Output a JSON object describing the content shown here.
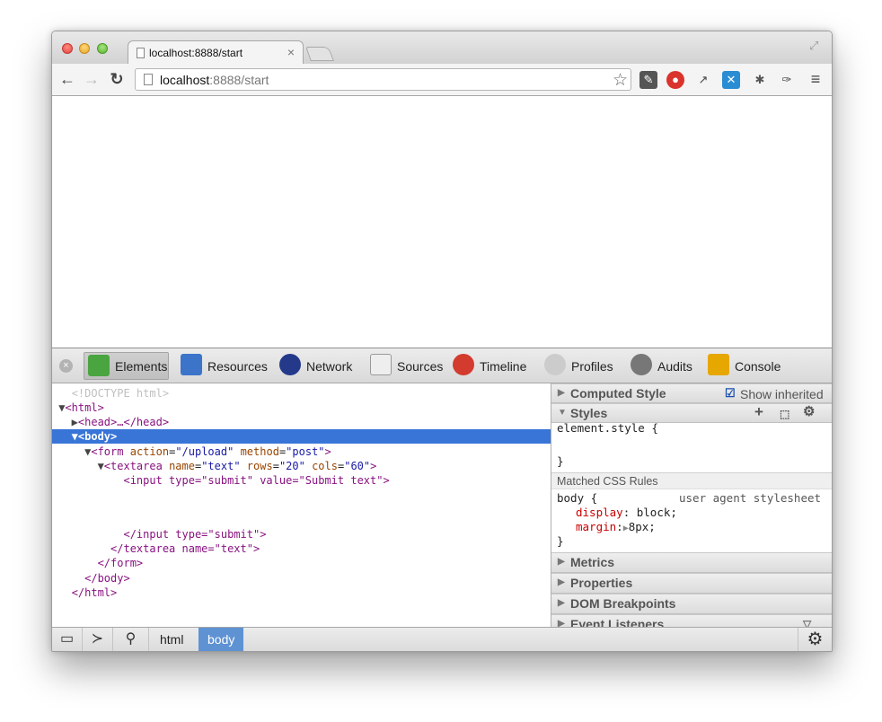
{
  "browser": {
    "tab_title": "localhost:8888/start",
    "tab_close": "×",
    "url_host": "localhost",
    "url_path": ":8888/start",
    "back_icon": "←",
    "forward_icon": "→",
    "reload_icon": "↻",
    "star_icon": "☆",
    "menu_icon": "≡",
    "fullscreen_icon": "⤢"
  },
  "devtools": {
    "close_icon": "×",
    "tabs": [
      {
        "label": "Elements",
        "icon": "elements-icon",
        "color": "#4aa540"
      },
      {
        "label": "Resources",
        "icon": "resources-icon",
        "color": "#3b74c9"
      },
      {
        "label": "Network",
        "icon": "network-icon",
        "color": "#24398a"
      },
      {
        "label": "Sources",
        "icon": "sources-icon",
        "color": "#cc3333"
      },
      {
        "label": "Timeline",
        "icon": "timeline-icon",
        "color": "#d23b2e"
      },
      {
        "label": "Profiles",
        "icon": "profiles-icon",
        "color": "#999999"
      },
      {
        "label": "Audits",
        "icon": "audits-icon",
        "color": "#555555"
      },
      {
        "label": "Console",
        "icon": "console-icon",
        "color": "#e6a700"
      }
    ],
    "dom": {
      "doctype": "<!DOCTYPE html>",
      "html_open": "<html>",
      "head": "<head>…</head>",
      "body_open": "<body>",
      "form_tag": "<form",
      "form_attr1": "action",
      "form_val1": "\"/upload\"",
      "form_attr2": "method",
      "form_val2": "\"post\"",
      "textarea_tag": "<textarea",
      "ta_attr1": "name",
      "ta_val1": "\"text\"",
      "ta_attr2": "rows",
      "ta_val2": "\"20\"",
      "ta_attr3": "cols",
      "ta_val3": "\"60\"",
      "input_line": "<input type=\"submit\" value=\"Submit text\">",
      "input_close": "</input type=\"submit\">",
      "textarea_close": "</textarea name=\"text\">",
      "form_close": "</form>",
      "body_close": "</body>",
      "html_close": "</html>"
    },
    "sidebar": {
      "computed_style": "Computed Style",
      "show_inherited": "Show inherited",
      "styles": "Styles",
      "element_style_open": "element.style {",
      "element_style_close": "}",
      "matched_rules": "Matched CSS Rules",
      "body_selector": "body {",
      "ua_stylesheet": "user agent stylesheet",
      "prop_display": "display",
      "val_display": "block;",
      "prop_margin": "margin",
      "val_margin": "8px;",
      "rule_close": "}",
      "metrics": "Metrics",
      "properties": "Properties",
      "dom_breakpoints": "DOM Breakpoints",
      "event_listeners": "Event Listeners"
    },
    "breadcrumbs": [
      "html",
      "body"
    ]
  }
}
